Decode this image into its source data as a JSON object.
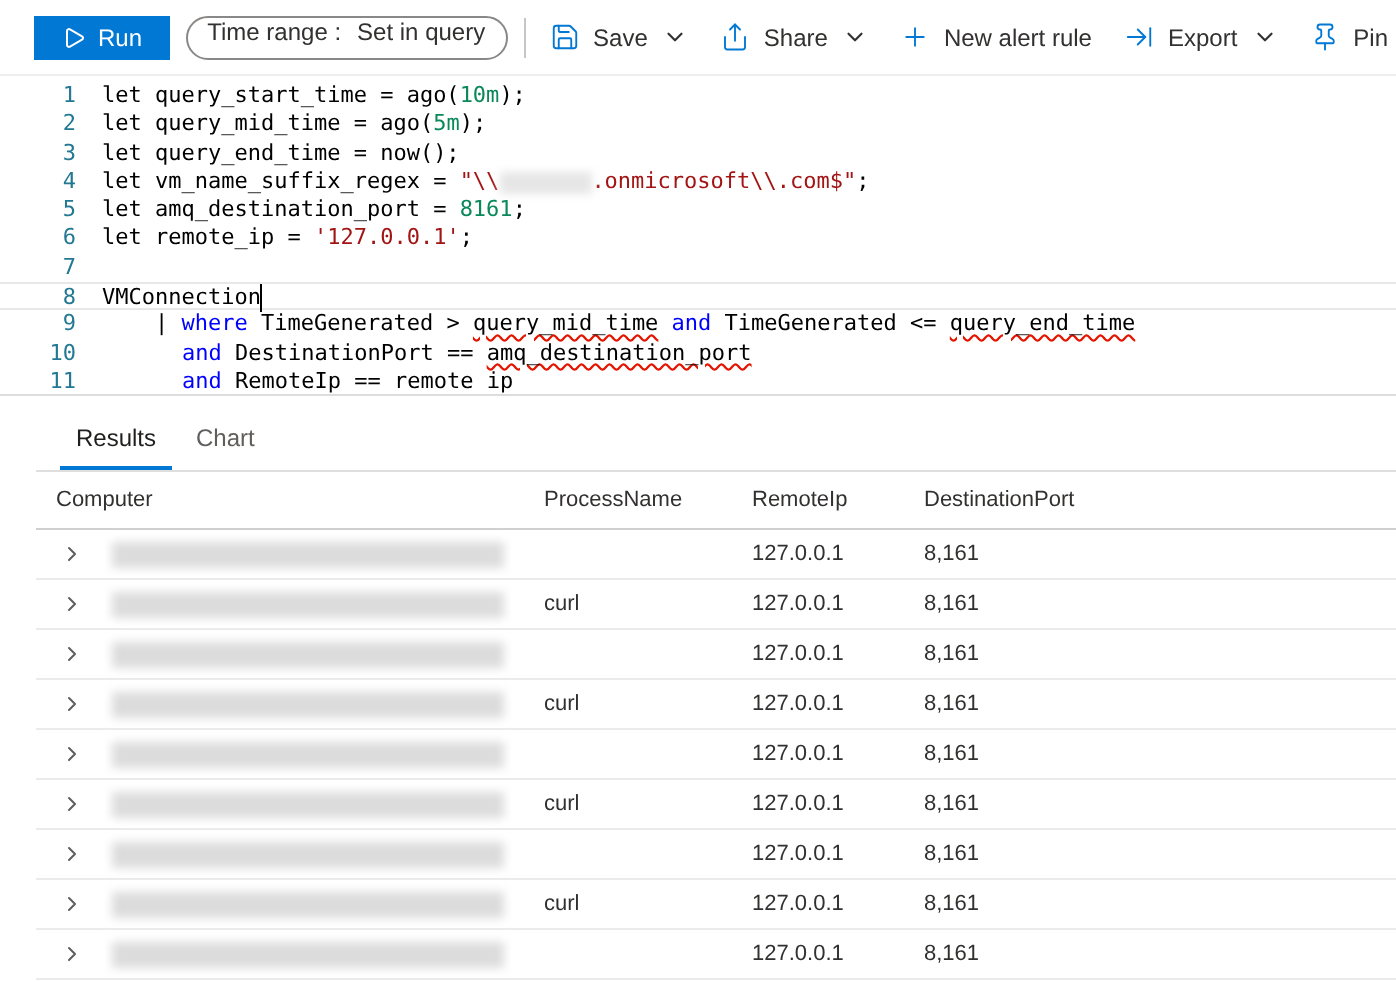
{
  "toolbar": {
    "run_label": "Run",
    "time_range": {
      "label": "Time range :",
      "value": "Set in query"
    },
    "actions": [
      {
        "kind": "save",
        "label": "Save",
        "dropdown": true
      },
      {
        "kind": "share",
        "label": "Share",
        "dropdown": true
      },
      {
        "kind": "plus",
        "label": "New alert rule",
        "dropdown": false
      },
      {
        "kind": "export",
        "label": "Export",
        "dropdown": true
      },
      {
        "kind": "pin",
        "label": "Pin",
        "dropdown": false
      }
    ]
  },
  "editor": {
    "lines": [
      {
        "number": "1",
        "tokens": [
          {
            "kind": "plain",
            "text": "let query_start_time = ago("
          },
          {
            "kind": "number",
            "text": "10m"
          },
          {
            "kind": "plain",
            "text": ");"
          }
        ]
      },
      {
        "number": "2",
        "tokens": [
          {
            "kind": "plain",
            "text": "let query_mid_time = ago("
          },
          {
            "kind": "number",
            "text": "5m"
          },
          {
            "kind": "plain",
            "text": ");"
          }
        ]
      },
      {
        "number": "3",
        "tokens": [
          {
            "kind": "plain",
            "text": "let query_end_time = now();"
          }
        ]
      },
      {
        "number": "4",
        "tokens": [
          {
            "kind": "plain",
            "text": "let vm_name_suffix_regex = "
          },
          {
            "kind": "string",
            "text": "\"\\\\"
          },
          {
            "kind": "redacted"
          },
          {
            "kind": "string",
            "text": ".onmicrosoft\\\\.com$\""
          },
          {
            "kind": "plain",
            "text": ";"
          }
        ]
      },
      {
        "number": "5",
        "tokens": [
          {
            "kind": "plain",
            "text": "let amq_destination_port = "
          },
          {
            "kind": "number",
            "text": "8161"
          },
          {
            "kind": "plain",
            "text": ";"
          }
        ]
      },
      {
        "number": "6",
        "tokens": [
          {
            "kind": "plain",
            "text": "let remote_ip = "
          },
          {
            "kind": "string",
            "text": "'127.0.0.1'"
          },
          {
            "kind": "plain",
            "text": ";"
          }
        ]
      },
      {
        "number": "7"
      },
      {
        "number": "8",
        "current": true,
        "tokens": [
          {
            "kind": "plain",
            "text": "VMConnection"
          }
        ]
      },
      {
        "number": "9",
        "tokens": [
          {
            "kind": "plain",
            "text": "    | "
          },
          {
            "kind": "keyword",
            "text": "where"
          },
          {
            "kind": "plain",
            "text": " TimeGenerated > "
          },
          {
            "kind": "squiggle",
            "text": "query_mid_time"
          },
          {
            "kind": "keyword",
            "text": " and"
          },
          {
            "kind": "plain",
            "text": " TimeGenerated <= "
          },
          {
            "kind": "squiggle",
            "text": "query_end_time"
          }
        ]
      },
      {
        "number": "10",
        "continuation": true,
        "tokens": [
          {
            "kind": "keyword",
            "text": "and"
          },
          {
            "kind": "plain",
            "text": " DestinationPort == "
          },
          {
            "kind": "squiggle",
            "text": "amq_destination_port"
          }
        ]
      },
      {
        "number": "11",
        "continuation": true,
        "tokens": [
          {
            "kind": "keyword",
            "text": "and"
          },
          {
            "kind": "plain",
            "text": " RemoteIp == remote ip"
          }
        ]
      }
    ]
  },
  "results": {
    "tabs": [
      {
        "label": "Results",
        "selected": true
      },
      {
        "label": "Chart",
        "selected": false
      }
    ],
    "columns": [
      "Computer",
      "ProcessName",
      "RemoteIp",
      "DestinationPort"
    ],
    "rows": [
      {
        "remote_ip": "127.0.0.1",
        "port": "8,161"
      },
      {
        "process": "curl",
        "remote_ip": "127.0.0.1",
        "port": "8,161"
      },
      {
        "remote_ip": "127.0.0.1",
        "port": "8,161"
      },
      {
        "process": "curl",
        "remote_ip": "127.0.0.1",
        "port": "8,161"
      },
      {
        "remote_ip": "127.0.0.1",
        "port": "8,161"
      },
      {
        "process": "curl",
        "remote_ip": "127.0.0.1",
        "port": "8,161"
      },
      {
        "remote_ip": "127.0.0.1",
        "port": "8,161"
      },
      {
        "process": "curl",
        "remote_ip": "127.0.0.1",
        "port": "8,161"
      },
      {
        "remote_ip": "127.0.0.1",
        "port": "8,161"
      }
    ]
  }
}
